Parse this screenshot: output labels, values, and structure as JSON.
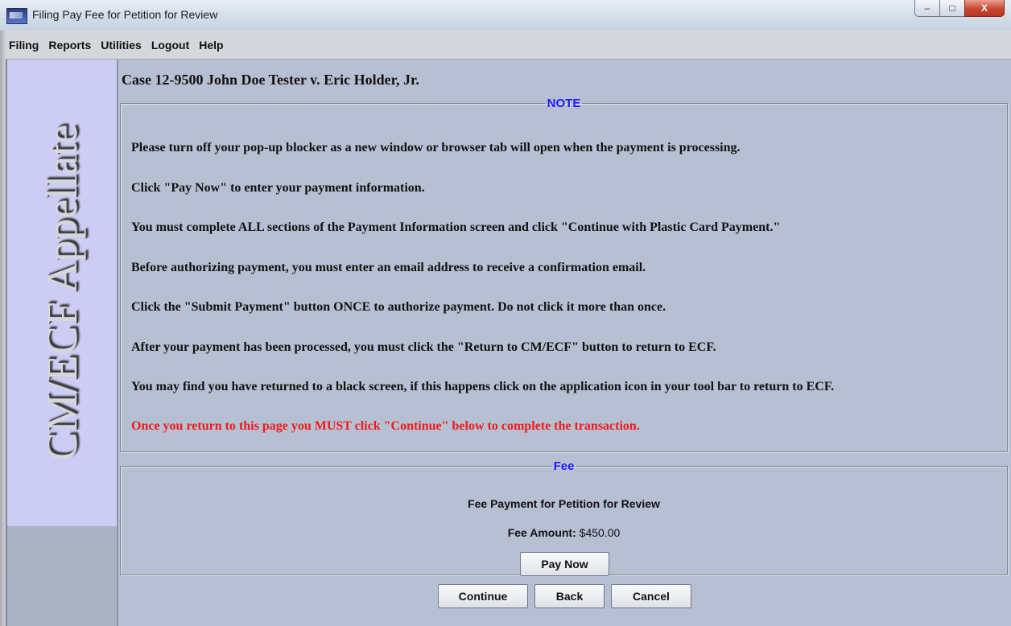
{
  "window": {
    "title": "Filing Pay Fee for Petition for Review",
    "controls": {
      "minimize": "–",
      "maximize": "□",
      "close": "X"
    }
  },
  "menu": [
    "Filing",
    "Reports",
    "Utilities",
    "Logout",
    "Help"
  ],
  "sidebar": {
    "brand": "CM/ECF Appellate"
  },
  "case": {
    "title": "Case 12-9500 John Doe Tester v. Eric Holder, Jr."
  },
  "note": {
    "legend": "NOTE",
    "lines": [
      "Please turn off your pop-up blocker as a new window or browser tab will open when the payment is processing.",
      "Click \"Pay Now\" to enter your payment information.",
      "You must complete ALL sections of the Payment Information screen and click \"Continue with Plastic Card Payment.\"",
      "Before authorizing payment, you must enter an email address to receive a confirmation email.",
      "Click the \"Submit Payment\" button ONCE to authorize payment. Do not click it more than once.",
      "After your payment has been processed, you must click the \"Return to CM/ECF\" button to return to ECF.",
      "You may find you have returned to a black screen, if this happens click on the application icon in your tool bar to return to ECF."
    ],
    "warning": "Once you return to this page you MUST click \"Continue\" below to complete the transaction.",
    "warning_color": "#f01a1a",
    "legend_color": "#1a1aff"
  },
  "fee": {
    "legend": "Fee",
    "description": "Fee Payment for Petition for Review",
    "amount_label": "Fee Amount:",
    "amount_value": "$450.00",
    "pay_button": "Pay Now"
  },
  "actions": {
    "continue": "Continue",
    "back": "Back",
    "cancel": "Cancel"
  }
}
